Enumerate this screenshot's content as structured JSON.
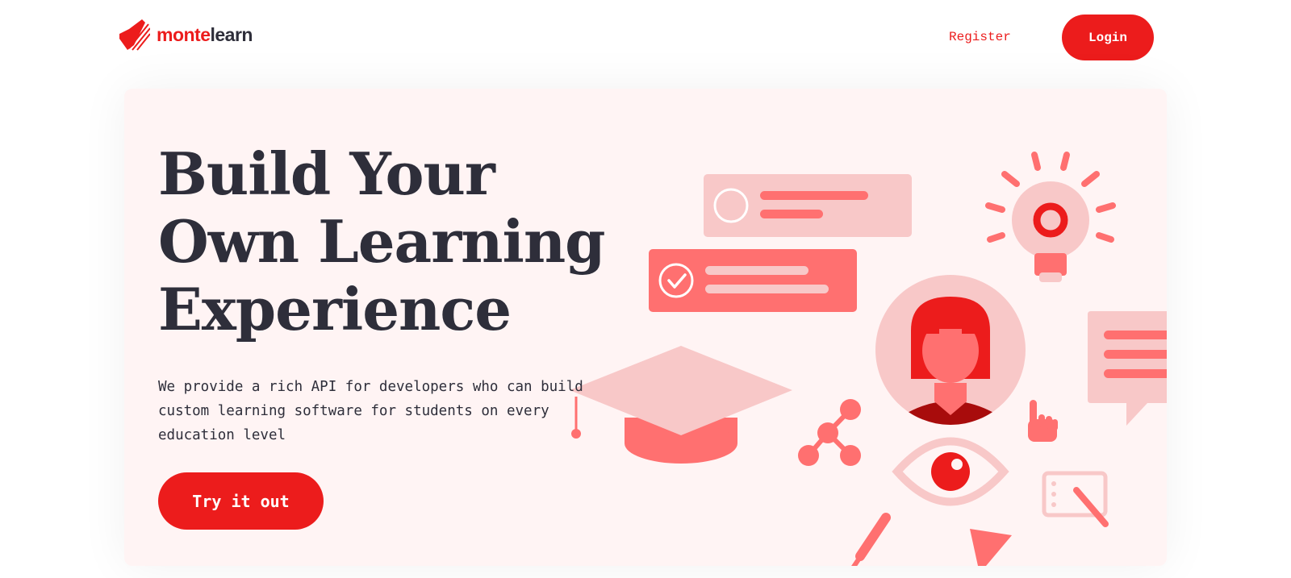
{
  "brand": {
    "name_part1": "monte",
    "name_part2": "learn"
  },
  "nav": {
    "register_label": "Register",
    "login_label": "Login"
  },
  "hero": {
    "title_lines": [
      "Build Your",
      "Own Learning",
      "Experience"
    ],
    "description": "We provide a rich API for developers who can build custom learning software for students on every education level",
    "cta_label": "Try it out"
  },
  "colors": {
    "accent": "#ec1c1c",
    "text": "#2e2e3a",
    "hero_bg": "#fff4f4",
    "soft_red": "#ff7070",
    "light_pink": "#f8c8c8"
  }
}
